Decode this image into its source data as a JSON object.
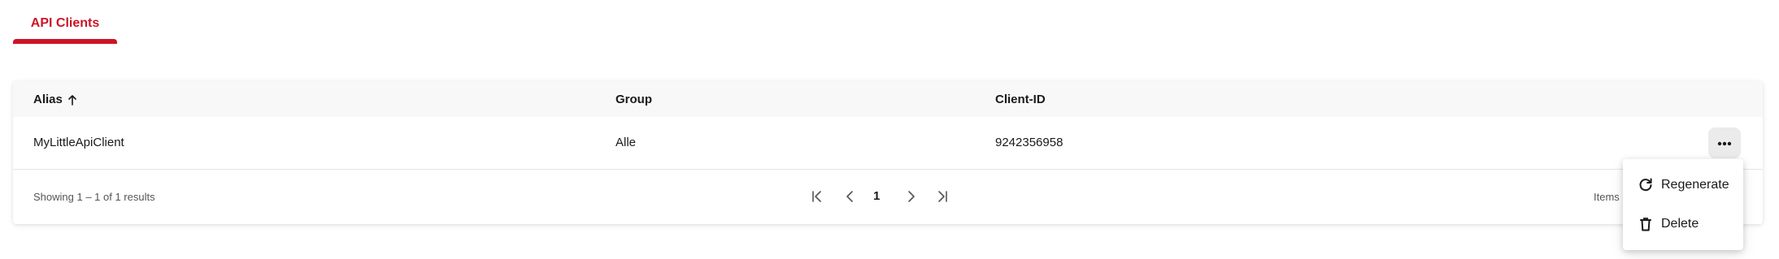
{
  "tabs": [
    {
      "label": "API Clients",
      "active": true
    }
  ],
  "table": {
    "columns": [
      {
        "label": "Alias",
        "sort": "ascending"
      },
      {
        "label": "Group"
      },
      {
        "label": "Client-ID"
      }
    ],
    "rows": [
      {
        "alias": "MyLittleApiClient",
        "group": "Alle",
        "client_id": "9242356958"
      }
    ]
  },
  "paginator": {
    "showing": "Showing 1 – 1 of 1 results",
    "current_page": "1",
    "items_per_page_label": "Items p"
  },
  "row_menu": {
    "items": [
      {
        "label": "Regenerate",
        "icon": "refresh-icon"
      },
      {
        "label": "Delete",
        "icon": "trash-icon"
      }
    ]
  },
  "colors": {
    "accent": "#cc1526",
    "header_bg": "#f8f8f8",
    "action_button_bg": "#ebebeb"
  }
}
